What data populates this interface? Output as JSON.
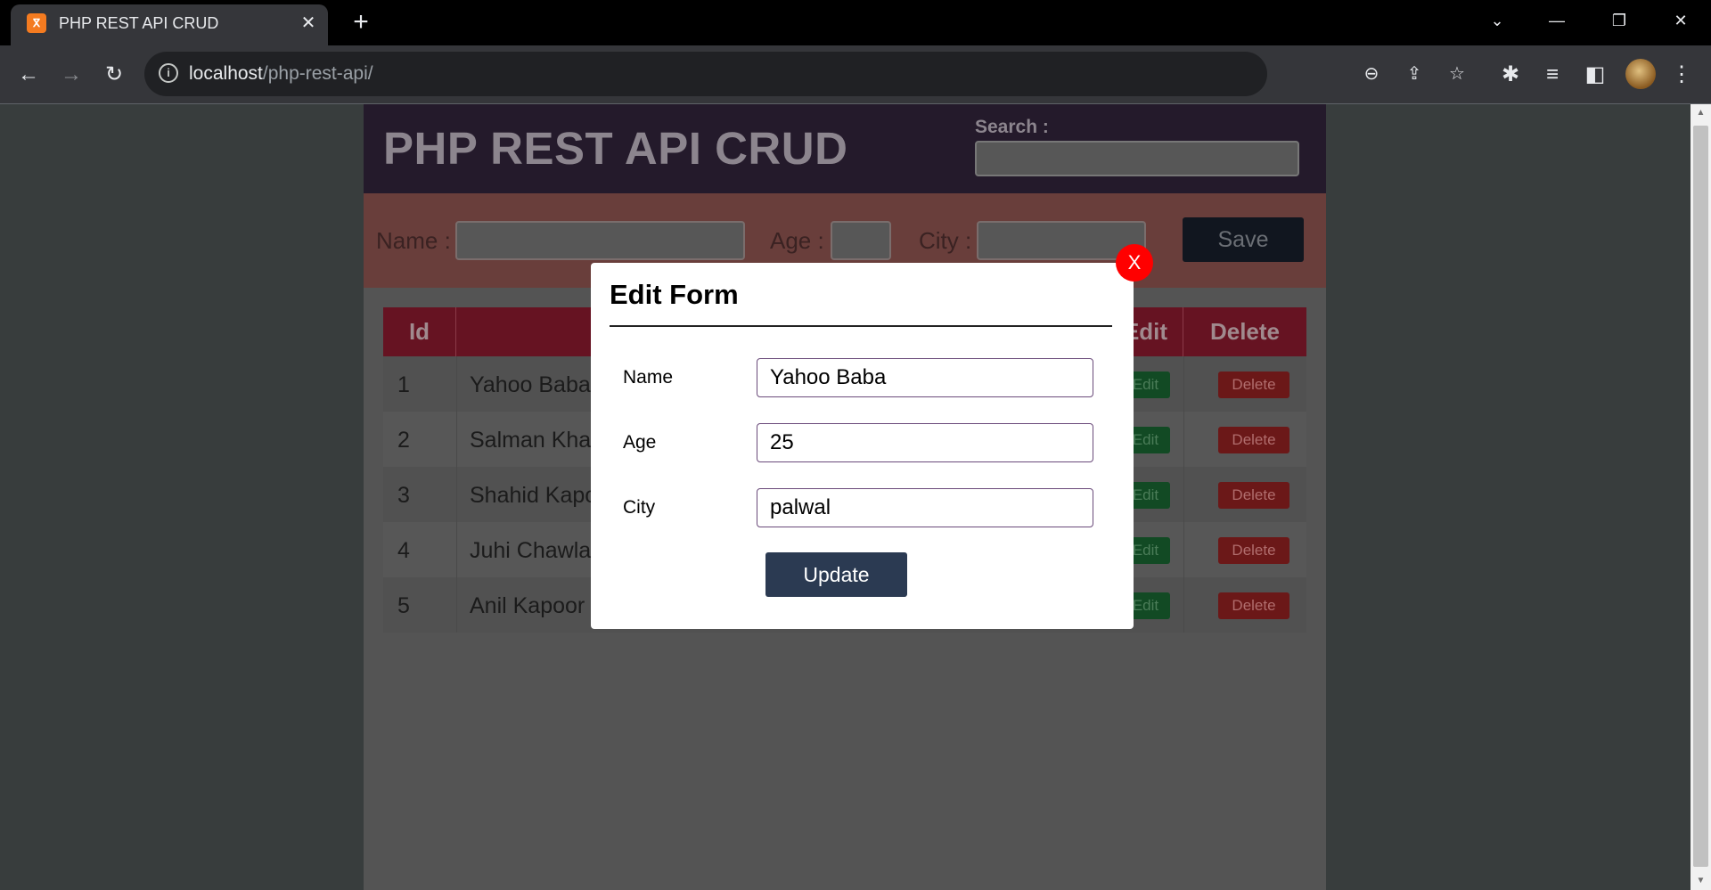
{
  "browser": {
    "tab_title": "PHP REST API CRUD",
    "url_host": "localhost",
    "url_path": "/php-rest-api/",
    "icons": {
      "back": "arrow-left-icon",
      "forward": "arrow-right-icon",
      "reload": "reload-icon",
      "info": "info-icon",
      "zoom": "zoom-out-icon",
      "share": "share-icon",
      "bookmark": "star-icon",
      "extensions": "puzzle-icon",
      "media": "media-queue-icon",
      "sidepanel": "side-panel-icon",
      "menu": "kebab-menu-icon"
    }
  },
  "app": {
    "title": "PHP REST API CRUD",
    "search_label": "Search :",
    "form": {
      "name_label": "Name :",
      "age_label": "Age :",
      "city_label": "City :",
      "save_label": "Save"
    },
    "table": {
      "headers": [
        "Id",
        "",
        "",
        "",
        "Edit",
        "Delete"
      ],
      "rows": [
        {
          "id": "1",
          "name": "Yahoo Baba",
          "edit": "Edit",
          "delete": "Delete"
        },
        {
          "id": "2",
          "name": "Salman Khan",
          "edit": "Edit",
          "delete": "Delete"
        },
        {
          "id": "3",
          "name": "Shahid Kapoor",
          "edit": "Edit",
          "delete": "Delete"
        },
        {
          "id": "4",
          "name": "Juhi Chawla",
          "edit": "Edit",
          "delete": "Delete"
        },
        {
          "id": "5",
          "name": "Anil Kapoor",
          "edit": "Edit",
          "delete": "Delete"
        }
      ]
    }
  },
  "modal": {
    "title": "Edit Form",
    "close_label": "X",
    "fields": [
      {
        "label": "Name",
        "value": "Yahoo Baba"
      },
      {
        "label": "Age",
        "value": "25"
      },
      {
        "label": "City",
        "value": "palwal"
      }
    ],
    "update_label": "Update"
  },
  "colors": {
    "header_bg": "#241a2b",
    "form_bg": "#693e3b",
    "table_header": "#661322",
    "close_button": "#ff0000",
    "update_button": "#2b3a52"
  }
}
